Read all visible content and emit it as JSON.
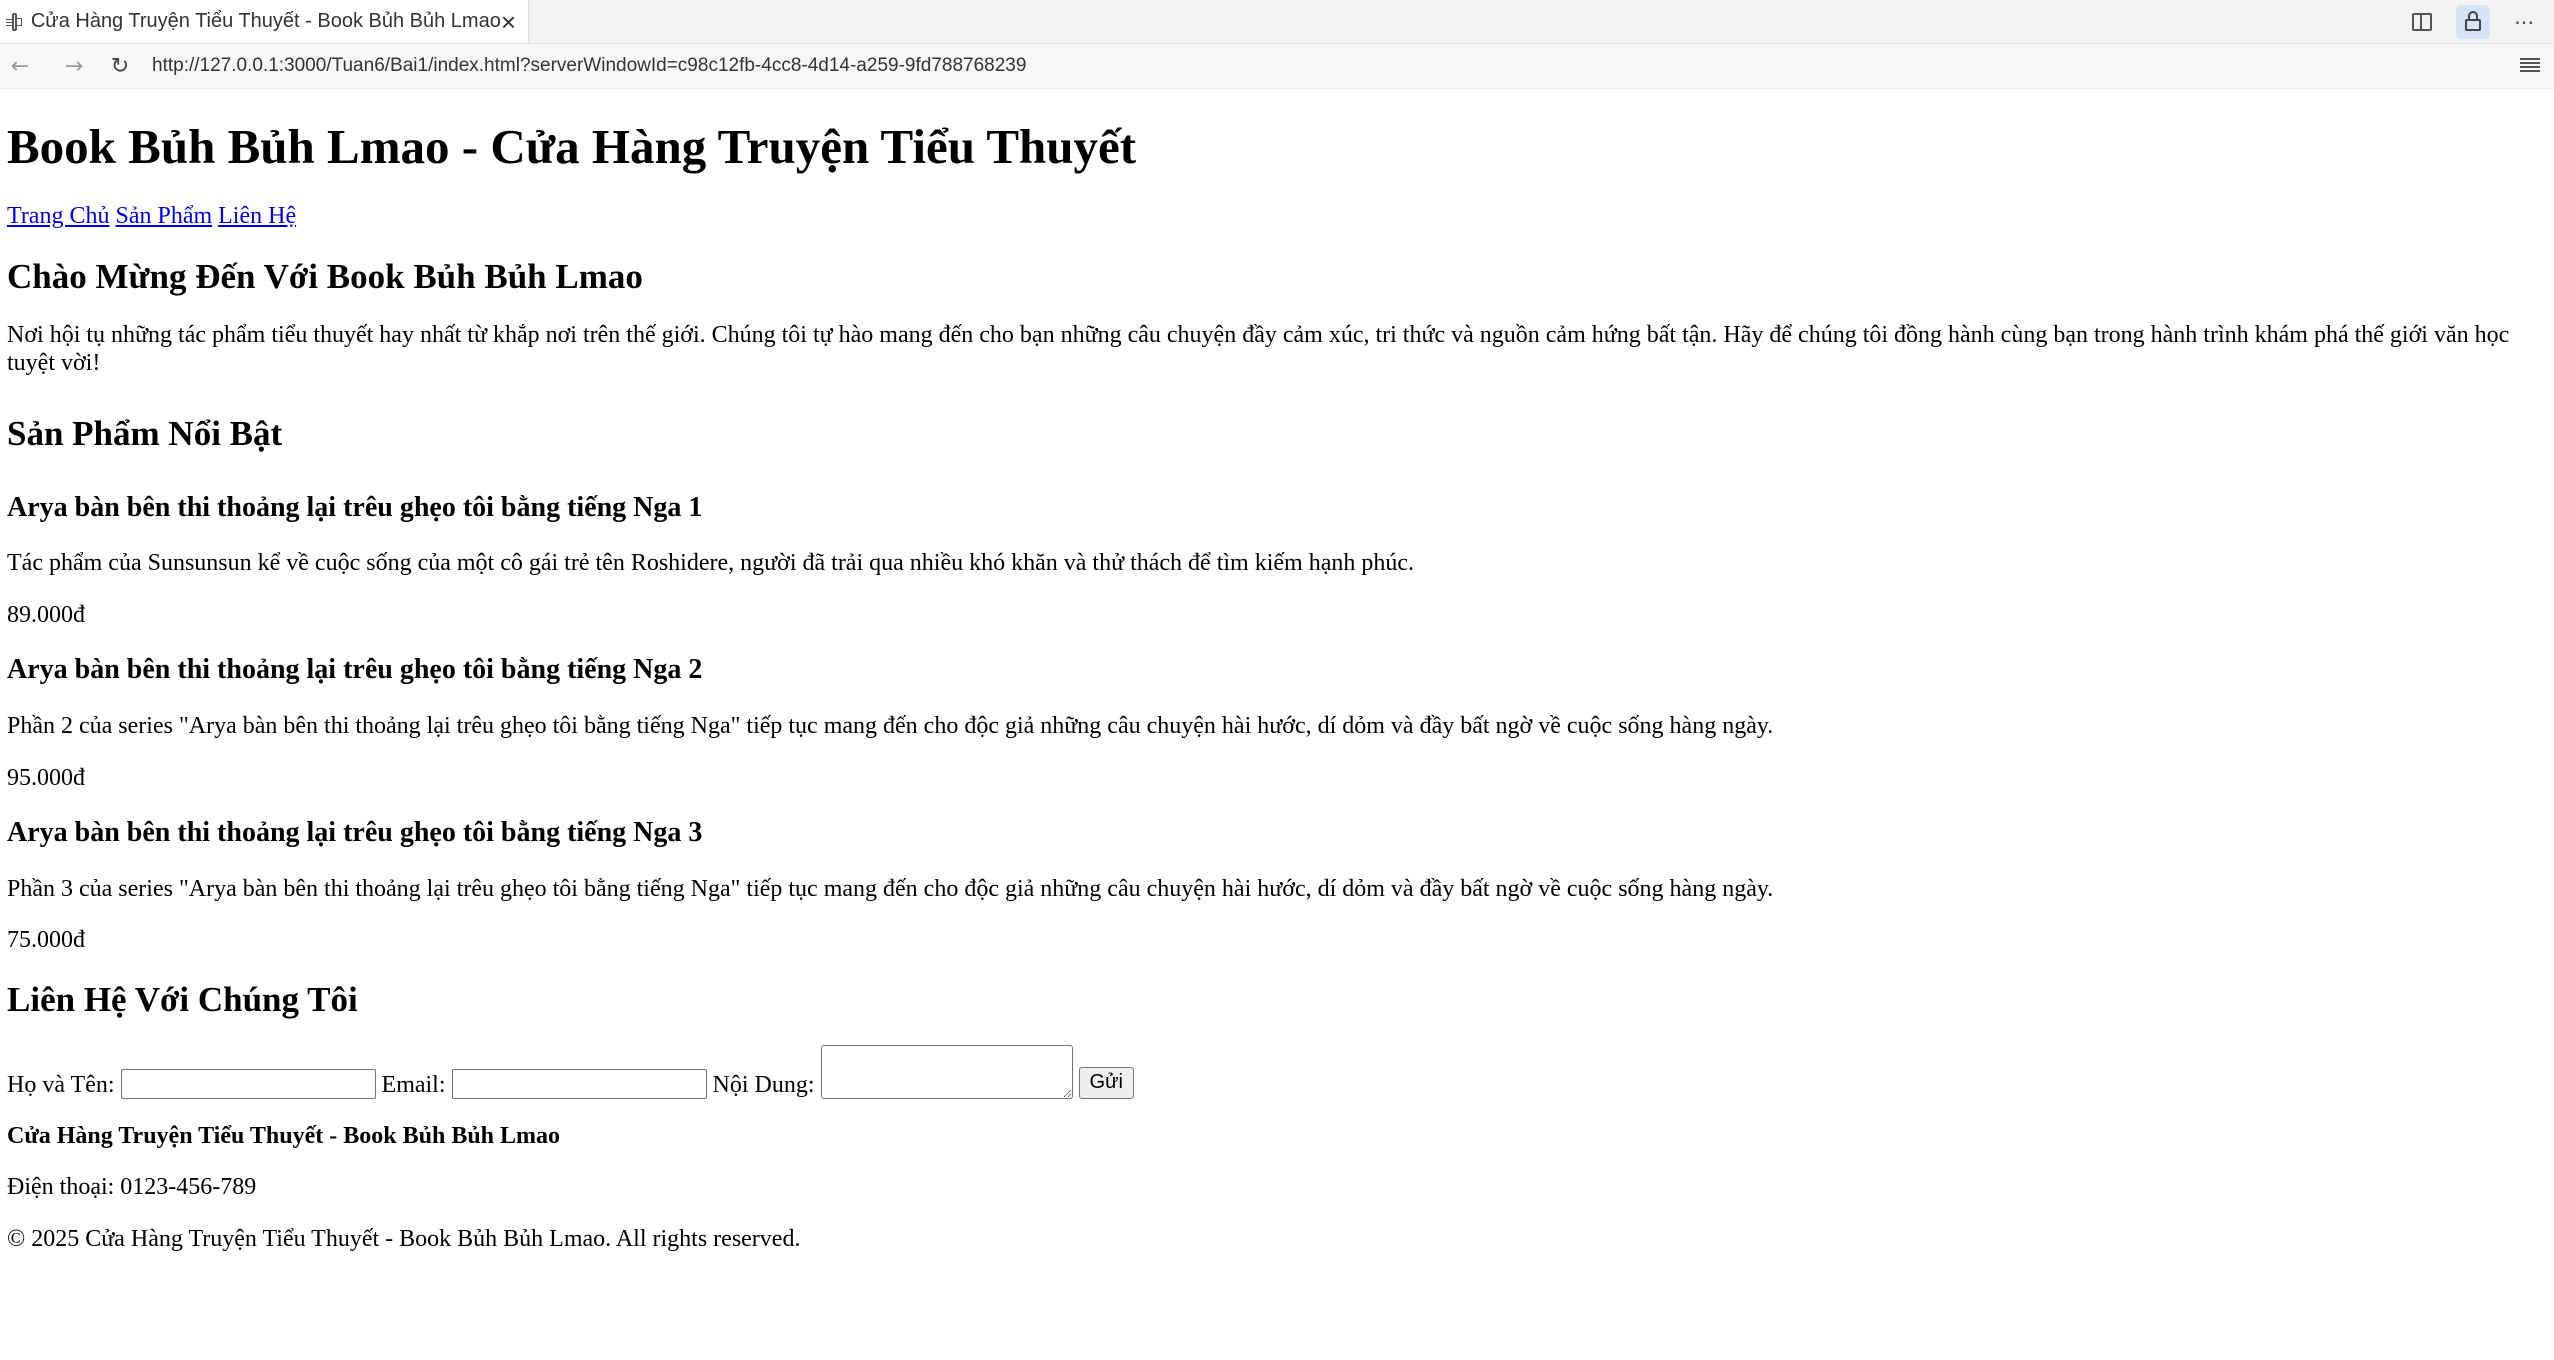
{
  "browser": {
    "tab_title": "Cửa Hàng Truyện Tiểu Thuyết - Book Bủh Bủh Lmao",
    "url": "http://127.0.0.1:3000/Tuan6/Bai1/index.html?serverWindowId=c98c12fb-4cc8-4d14-a259-9fd788768239",
    "icons": [
      "page-icon",
      "close-icon",
      "split-view-icon",
      "lock-icon",
      "more-icon",
      "back-icon",
      "forward-icon",
      "reload-icon",
      "reader-mode-icon"
    ]
  },
  "header": {
    "title": "Book Bủh Bủh Lmao - Cửa Hàng Truyện Tiểu Thuyết",
    "nav": [
      "Trang Chủ",
      "Sản Phẩm",
      "Liên Hệ"
    ]
  },
  "welcome": {
    "title": "Chào Mừng Đến Với Book Bủh Bủh Lmao",
    "text": "Nơi hội tụ những tác phẩm tiểu thuyết hay nhất từ khắp nơi trên thế giới. Chúng tôi tự hào mang đến cho bạn những câu chuyện đầy cảm xúc, tri thức và nguồn cảm hứng bất tận. Hãy để chúng tôi đồng hành cùng bạn trong hành trình khám phá thế giới văn học tuyệt vời!"
  },
  "products": {
    "title": "Sản Phẩm Nổi Bật",
    "items": [
      {
        "name": "Arya bàn bên thi thoảng lại trêu ghẹo tôi bằng tiếng Nga 1",
        "description": "Tác phẩm của Sunsunsun kể về cuộc sống của một cô gái trẻ tên Roshidere, người đã trải qua nhiều khó khăn và thử thách để tìm kiếm hạnh phúc.",
        "price": "89.000đ"
      },
      {
        "name": "Arya bàn bên thi thoảng lại trêu ghẹo tôi bằng tiếng Nga 2",
        "description": "Phần 2 của series \"Arya bàn bên thi thoảng lại trêu ghẹo tôi bằng tiếng Nga\" tiếp tục mang đến cho độc giả những câu chuyện hài hước, dí dỏm và đầy bất ngờ về cuộc sống hàng ngày.",
        "price": "95.000đ"
      },
      {
        "name": "Arya bàn bên thi thoảng lại trêu ghẹo tôi bằng tiếng Nga 3",
        "description": "Phần 3 của series \"Arya bàn bên thi thoảng lại trêu ghẹo tôi bằng tiếng Nga\" tiếp tục mang đến cho độc giả những câu chuyện hài hước, dí dỏm và đầy bất ngờ về cuộc sống hàng ngày.",
        "price": "75.000đ"
      }
    ]
  },
  "contact": {
    "title": "Liên Hệ Với Chúng Tôi",
    "name_label": "Họ và Tên:",
    "name_value": "",
    "email_label": "Email:",
    "email_value": "",
    "content_label": "Nội Dung:",
    "content_value": "",
    "submit_label": "Gửi"
  },
  "footer": {
    "name": "Cửa Hàng Truyện Tiểu Thuyết - Book Bủh Bủh Lmao",
    "phone": "Điện thoại: 0123-456-789",
    "copyright": "© 2025 Cửa Hàng Truyện Tiểu Thuyết - Book Bủh Bủh Lmao. All rights reserved."
  }
}
